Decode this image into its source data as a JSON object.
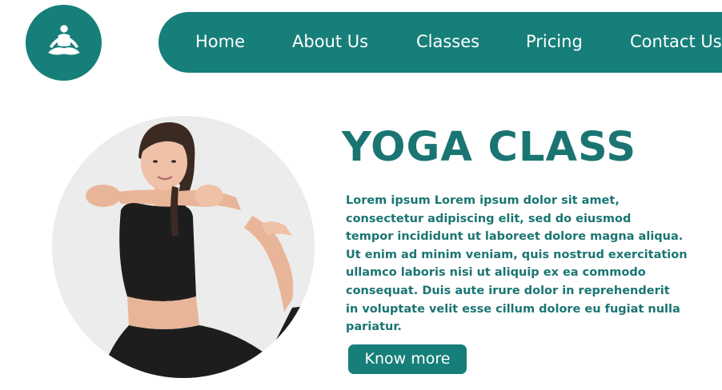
{
  "nav": {
    "items": [
      {
        "label": "Home"
      },
      {
        "label": "About Us"
      },
      {
        "label": "Classes"
      },
      {
        "label": "Pricing"
      },
      {
        "label": "Contact Us"
      }
    ]
  },
  "hero": {
    "title": "YOGA CLASS",
    "body_lines": [
      "Lorem ipsum Lorem ipsum dolor sit amet,",
      "consectetur adipiscing elit, sed do eiusmod",
      "tempor incididunt ut laboreet dolore magna aliqua.",
      "Ut enim ad minim veniam, quis nostrud exercitation",
      "ullamco laboris nisi ut aliquip ex ea commodo",
      "consequat. Duis aute irure dolor in reprehenderit",
      "in voluptate velit esse cillum dolore eu fugiat nulla",
      "pariatur."
    ],
    "cta_label": "Know more"
  },
  "colors": {
    "brand": "#177f79",
    "title": "#1a7572",
    "background": "#ffffff"
  },
  "icons": {
    "logo": "meditation-icon"
  }
}
